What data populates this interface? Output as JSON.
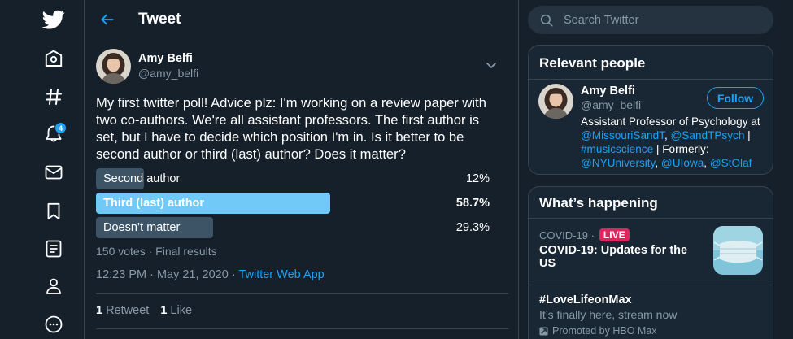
{
  "nav": {
    "notifications_count": "4",
    "icons": [
      "twitter-logo-icon",
      "home-icon",
      "hashtag-icon",
      "bell-icon",
      "mail-icon",
      "bookmark-icon",
      "list-icon",
      "profile-icon",
      "more-icon"
    ]
  },
  "header": {
    "title": "Tweet"
  },
  "tweet": {
    "author_name": "Amy Belfi",
    "author_handle": "@amy_belfi",
    "text": "My first twitter poll! Advice plz: I'm working on a review paper with two co-authors. We're all assistant professors. The first author is set, but I have to decide which position I'm in. Is it better to be second author or third (last) author? Does it matter?",
    "poll": {
      "options": [
        {
          "label": "Second author",
          "percent_label": "12%",
          "percent": 12,
          "winner": false
        },
        {
          "label": "Third (last) author",
          "percent_label": "58.7%",
          "percent": 58.7,
          "winner": true
        },
        {
          "label": "Doesn’t matter",
          "percent_label": "29.3%",
          "percent": 29.3,
          "winner": false
        }
      ],
      "meta": "150 votes · Final results"
    },
    "timestamp": "12:23 PM · May 21, 2020 · ",
    "source": "Twitter Web App",
    "retweets_count": "1",
    "retweets_label": "Retweet",
    "likes_count": "1",
    "likes_label": "Like"
  },
  "search": {
    "placeholder": "Search Twitter"
  },
  "relevant_people": {
    "title": "Relevant people",
    "name": "Amy Belfi",
    "handle": "@amy_belfi",
    "follow_label": "Follow",
    "bio": {
      "t1": "Assistant Professor of Psychology at ",
      "l1": "@MissouriSandT",
      "t2": ", ",
      "l2": "@SandTPsych",
      "t3": " | ",
      "l3": "#musicscience",
      "t4": " | Formerly: ",
      "l4": "@NYUniversity",
      "t5": ", ",
      "l5": "@UIowa",
      "t6": ", ",
      "l6": "@StOlaf"
    }
  },
  "whats_happening": {
    "title": "What’s happening",
    "trend_category": "COVID-19 ·",
    "live_label": "LIVE",
    "trend_title": "COVID-19: Updates for the US",
    "promo_title": "#LoveLifeonMax",
    "promo_subtitle": "It’s finally here, stream now",
    "promo_by": "Promoted by HBO Max"
  },
  "colors": {
    "background": "#15202b",
    "accent": "#1da1f2",
    "poll_winner": "#71c9f8",
    "poll_other": "#3d5466",
    "live": "#e0245e"
  }
}
